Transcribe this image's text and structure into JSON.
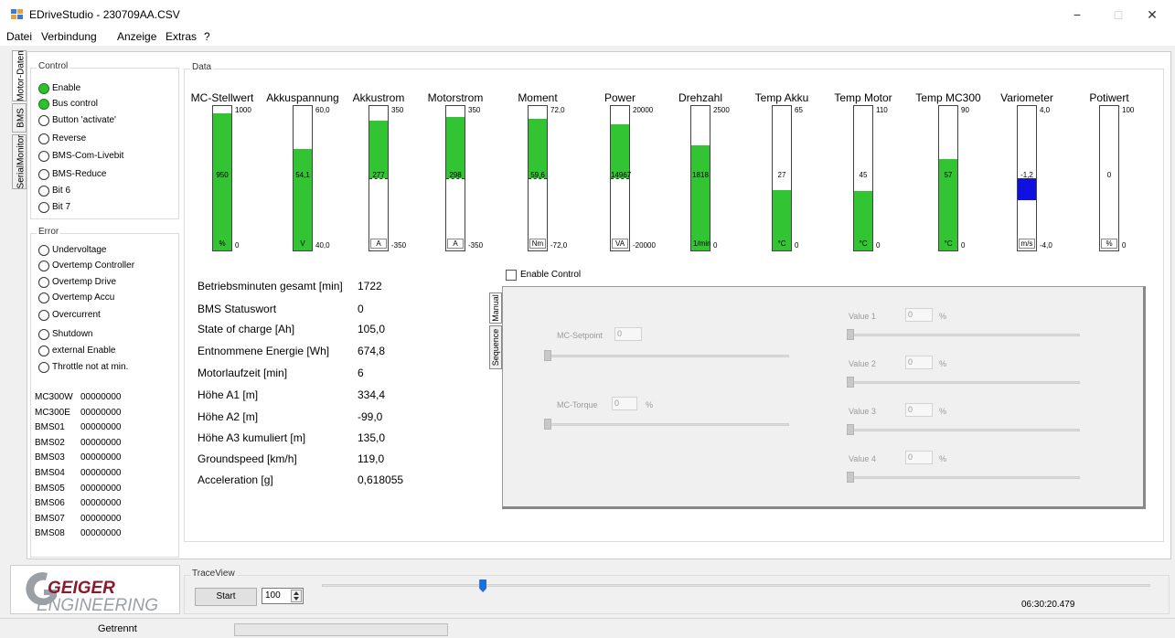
{
  "window": {
    "title": "EDriveStudio - 230709AA.CSV",
    "minimize_glyph": "−",
    "maximize_glyph": "□",
    "close_glyph": "✕"
  },
  "menu": [
    "Datei",
    "Verbindung",
    "Anzeige",
    "Extras",
    "?"
  ],
  "side_tabs": [
    "Motor-Daten",
    "BMS",
    "SerialMonitor"
  ],
  "control": {
    "label": "Control",
    "items": [
      {
        "label": "Enable",
        "on": true
      },
      {
        "label": "Bus control",
        "on": true
      },
      {
        "label": "Button 'activate'",
        "on": false
      },
      {
        "label": "Reverse",
        "on": false
      },
      {
        "label": "BMS-Com-Livebit",
        "on": false
      },
      {
        "label": "BMS-Reduce",
        "on": false
      },
      {
        "label": "Bit 6",
        "on": false
      },
      {
        "label": "Bit 7",
        "on": false
      }
    ]
  },
  "error": {
    "label": "Error",
    "items": [
      {
        "label": "Undervoltage",
        "on": false
      },
      {
        "label": "Overtemp Controller",
        "on": false
      },
      {
        "label": "Overtemp Drive",
        "on": false
      },
      {
        "label": "Overtemp Accu",
        "on": false
      },
      {
        "label": "Overcurrent",
        "on": false
      },
      {
        "label": "Shutdown",
        "on": false
      },
      {
        "label": "external Enable",
        "on": false
      },
      {
        "label": "Throttle not at min.",
        "on": false
      }
    ],
    "registers": [
      {
        "name": "MC300W",
        "value": "00000000"
      },
      {
        "name": "MC300E",
        "value": "00000000"
      },
      {
        "name": "BMS01",
        "value": "00000000"
      },
      {
        "name": "BMS02",
        "value": "00000000"
      },
      {
        "name": "BMS03",
        "value": "00000000"
      },
      {
        "name": "BMS04",
        "value": "00000000"
      },
      {
        "name": "BMS05",
        "value": "00000000"
      },
      {
        "name": "BMS06",
        "value": "00000000"
      },
      {
        "name": "BMS07",
        "value": "00000000"
      },
      {
        "name": "BMS08",
        "value": "00000000"
      }
    ]
  },
  "data": {
    "label": "Data",
    "gauges": [
      {
        "name": "MC-Stellwert",
        "value": "950",
        "unit": "%",
        "max": "1000",
        "min": "0",
        "fill": 0.95,
        "color": "#33c433"
      },
      {
        "name": "Akkuspannung",
        "value": "54,1",
        "unit": "V",
        "max": "60,0",
        "min": "40,0",
        "fill": 0.705,
        "color": "#33c433"
      },
      {
        "name": "Akkustrom",
        "value": "277",
        "unit": "A",
        "max": "350",
        "min": "-350",
        "fill": 0.896,
        "center": 0.5,
        "color": "#33c433"
      },
      {
        "name": "Motorstrom",
        "value": "298",
        "unit": "A",
        "max": "350",
        "min": "-350",
        "fill": 0.926,
        "center": 0.5,
        "color": "#33c433"
      },
      {
        "name": "Moment",
        "value": "59,6",
        "unit": "Nm",
        "max": "72,0",
        "min": "-72,0",
        "fill": 0.914,
        "center": 0.5,
        "color": "#33c433"
      },
      {
        "name": "Power",
        "value": "14967",
        "unit": "VA",
        "max": "20000",
        "min": "-20000",
        "fill": 0.874,
        "center": 0.5,
        "color": "#33c433"
      },
      {
        "name": "Drehzahl",
        "value": "1818",
        "unit": "1/min",
        "max": "2500",
        "min": "0",
        "fill": 0.727,
        "color": "#33c433"
      },
      {
        "name": "Temp Akku",
        "value": "27",
        "unit": "°C",
        "max": "65",
        "min": "0",
        "fill": 0.415,
        "color": "#33c433"
      },
      {
        "name": "Temp Motor",
        "value": "45",
        "unit": "°C",
        "max": "110",
        "min": "0",
        "fill": 0.409,
        "color": "#33c433"
      },
      {
        "name": "Temp MC300",
        "value": "57",
        "unit": "°C",
        "max": "90",
        "min": "0",
        "fill": 0.633,
        "color": "#33c433"
      },
      {
        "name": "Variometer",
        "value": "-1,2",
        "unit": "m/s",
        "max": "4,0",
        "min": "-4,0",
        "fill": 0.35,
        "center": 0.5,
        "color": "#1010e0"
      },
      {
        "name": "Potiwert",
        "value": "0",
        "unit": "%",
        "max": "100",
        "min": "0",
        "fill": 0.0,
        "color": "#33c433"
      }
    ],
    "info": [
      {
        "label": "Betriebsminuten gesamt [min]",
        "value": "1722"
      },
      {
        "label": "BMS Statuswort",
        "value": "0"
      },
      {
        "label": "State of charge [Ah]",
        "value": "105,0"
      },
      {
        "label": "Entnommene Energie [Wh]",
        "value": "674,8"
      },
      {
        "label": "Motorlaufzeit [min]",
        "value": "6"
      },
      {
        "label": "Höhe A1 [m]",
        "value": "334,4"
      },
      {
        "label": "Höhe A2 [m]",
        "value": "-99,0"
      },
      {
        "label": "Höhe A3 kumuliert [m]",
        "value": "135,0"
      },
      {
        "label": "Groundspeed [km/h]",
        "value": "119,0"
      },
      {
        "label": "Acceleration [g]",
        "value": "0,618055"
      }
    ]
  },
  "manual": {
    "enable_control_label": "Enable Control",
    "enable_control_checked": false,
    "tabs": [
      "Manual",
      "Sequence"
    ],
    "setpoint_label": "MC-Setpoint",
    "setpoint_value": "0",
    "torque_label": "MC-Torque",
    "torque_value": "0",
    "torque_unit": "%",
    "values": [
      {
        "label": "Value 1",
        "value": "0",
        "unit": "%"
      },
      {
        "label": "Value 2",
        "value": "0",
        "unit": "%"
      },
      {
        "label": "Value 3",
        "value": "0",
        "unit": "%"
      },
      {
        "label": "Value 4",
        "value": "0",
        "unit": "%"
      }
    ]
  },
  "logo": {
    "line1": "GEIGER",
    "line2": "ENGINEERING"
  },
  "trace": {
    "label": "TraceView",
    "start_label": "Start",
    "count_value": "100",
    "position_fraction": 0.19,
    "time": "06:30:20.479"
  },
  "status": {
    "connection": "Getrennt"
  }
}
